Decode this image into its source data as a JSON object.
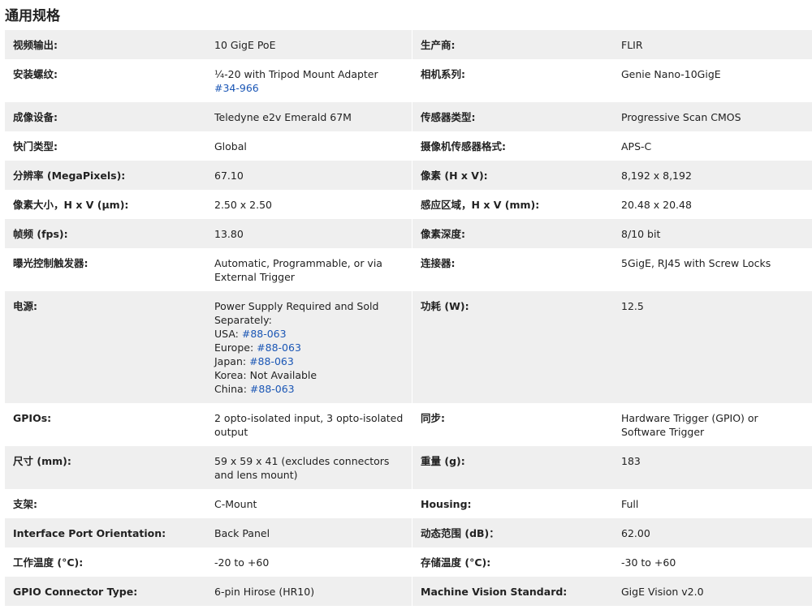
{
  "title": "通用规格",
  "rows": [
    {
      "l1": "视频输出:",
      "v1": "10 GigE PoE",
      "l2": "生产商:",
      "v2": "FLIR"
    },
    {
      "l1": "安装螺纹:",
      "v1_text": "¼-20 with Tripod Mount Adapter ",
      "v1_link": "#34-966",
      "l2": "相机系列:",
      "v2": "Genie Nano-10GigE"
    },
    {
      "l1": "成像设备:",
      "v1": "Teledyne e2v Emerald 67M",
      "l2": "传感器类型:",
      "v2": "Progressive Scan CMOS"
    },
    {
      "l1": "快门类型:",
      "v1": "Global",
      "l2": "摄像机传感器格式:",
      "v2": "APS-C"
    },
    {
      "l1": "分辨率 (MegaPixels):",
      "v1": "67.10",
      "l2": "像素 (H x V):",
      "v2": "8,192 x 8,192"
    },
    {
      "l1": "像素大小，H x V (μm):",
      "v1": "2.50 x 2.50",
      "l2": "感应区域，H x V (mm):",
      "v2": "20.48 x 20.48"
    },
    {
      "l1": "帧频 (fps):",
      "v1": "13.80",
      "l2": "像素深度:",
      "v2": "8/10 bit"
    },
    {
      "l1": "曝光控制触发器:",
      "v1": "Automatic, Programmable, or via External Trigger",
      "l2": "连接器:",
      "v2": "5GigE, RJ45 with Screw Locks"
    },
    {
      "l1": "电源:",
      "v1_head": "Power Supply Required and Sold Separately:",
      "usa_label": "USA: ",
      "usa_link": "#88-063",
      "europe_label": "Europe: ",
      "europe_link": "#88-063",
      "japan_label": "Japan: ",
      "japan_link": "#88-063",
      "korea": "Korea: Not Available",
      "china_label": "China: ",
      "china_link": "#88-063",
      "l2": "功耗 (W):",
      "v2": "12.5"
    },
    {
      "l1": "GPIOs:",
      "v1": "2 opto-isolated input, 3 opto-isolated output",
      "l2": "同步:",
      "v2": "Hardware Trigger (GPIO) or Software Trigger"
    },
    {
      "l1": "尺寸 (mm):",
      "v1": "59 x 59 x 41 (excludes connectors and lens mount)",
      "l2": "重量 (g):",
      "v2": "183"
    },
    {
      "l1": "支架:",
      "v1": "C-Mount",
      "l2": "Housing:",
      "v2": "Full"
    },
    {
      "l1": "Interface Port Orientation:",
      "v1": "Back Panel",
      "l2": "动态范围 (dB)：",
      "v2": "62.00"
    },
    {
      "l1": "工作温度 (°C):",
      "v1": "-20 to +60",
      "l2": "存储温度 (°C):",
      "v2": "-30 to +60"
    },
    {
      "l1": "GPIO Connector Type:",
      "v1": "6-pin Hirose (HR10)",
      "l2": "Machine Vision Standard:",
      "v2": "GigE Vision v2.0"
    }
  ]
}
